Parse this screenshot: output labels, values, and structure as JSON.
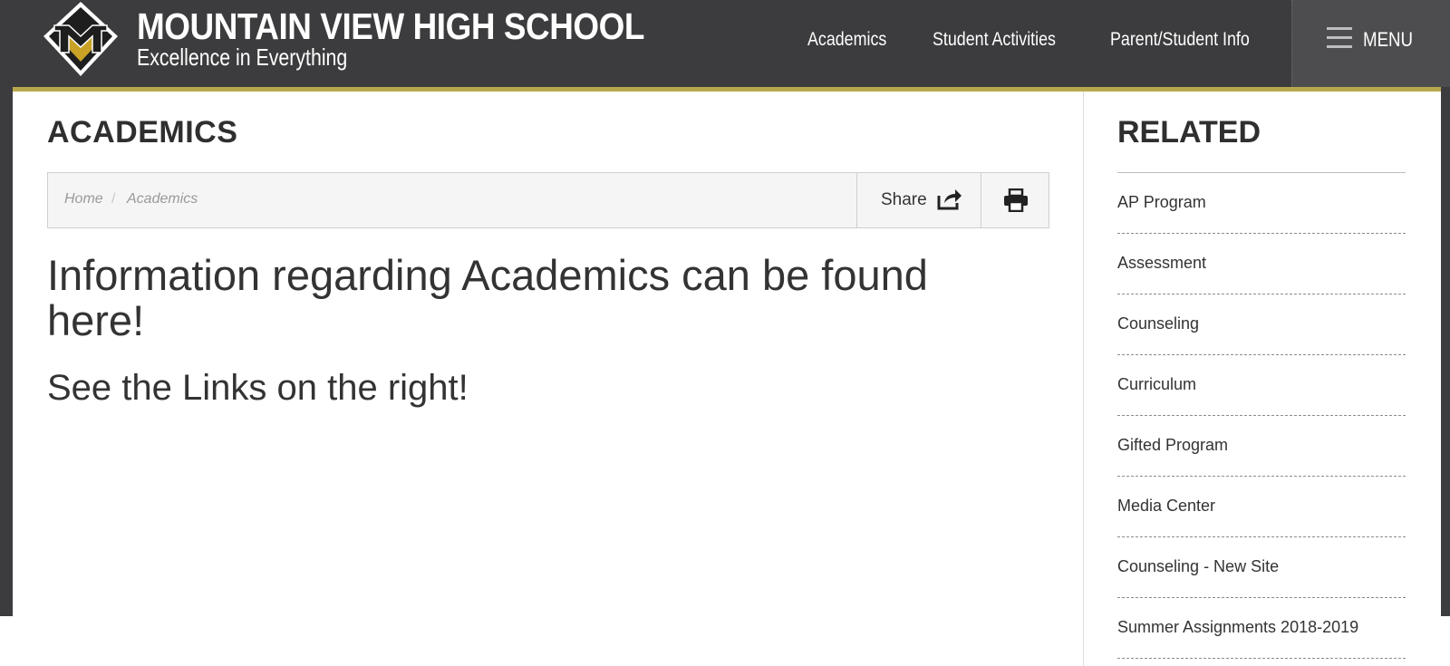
{
  "header": {
    "school_name": "MOUNTAIN VIEW HIGH SCHOOL",
    "tagline": "Excellence in Everything",
    "nav": [
      "Academics",
      "Student Activities",
      "Parent/Student Info"
    ],
    "menu_label": "MENU",
    "colors": {
      "bar": "#3c3c3e",
      "accent": "#b9a74f"
    }
  },
  "main": {
    "page_title": "ACADEMICS",
    "breadcrumb": [
      "Home",
      "Academics"
    ],
    "breadcrumb_separator": "/",
    "share_label": "Share",
    "headline": "Information regarding Academics can be found here!",
    "subline": "See the Links on the right!"
  },
  "related": {
    "title": "RELATED",
    "items": [
      "AP Program",
      "Assessment",
      "Counseling",
      "Curriculum",
      "Gifted Program",
      "Media Center",
      "Counseling - New Site",
      "Summer Assignments 2018-2019"
    ]
  },
  "icons": [
    "school-logo-icon",
    "hamburger-icon",
    "share-icon",
    "print-icon"
  ]
}
